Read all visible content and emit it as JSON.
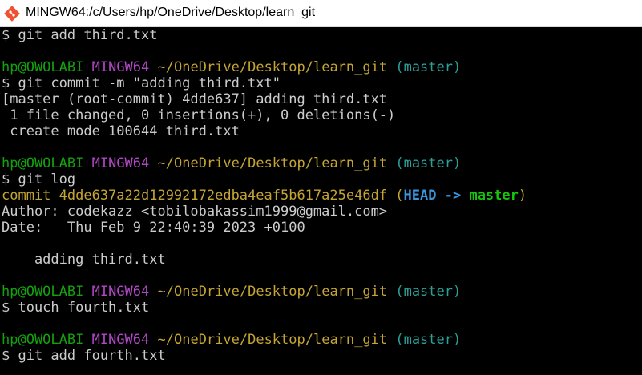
{
  "window": {
    "title": "MINGW64:/c/Users/hp/OneDrive/Desktop/learn_git",
    "app_icon": "git-bash-icon",
    "accent": "#f05133"
  },
  "prompt": {
    "user_host": "hp@OWOLABI",
    "system": "MINGW64",
    "path": "~/OneDrive/Desktop/learn_git",
    "branch": "(master)",
    "symbol": "$"
  },
  "terminal": {
    "lines": {
      "l0": "$ git add third.txt",
      "l2_cmd": "$ git commit -m \"adding third.txt\"",
      "l3": "[master (root-commit) 4dde637] adding third.txt",
      "l4": " 1 file changed, 0 insertions(+), 0 deletions(-)",
      "l5": " create mode 100644 third.txt",
      "l7_cmd": "$ git log",
      "l8_commit": "commit 4dde637a22d12992172edba4eaf5b617a25e46df",
      "l8_ref_open": "(",
      "l8_head": "HEAD ->",
      "l8_master": "master",
      "l8_ref_close": ")",
      "l9": "Author: codekazz <tobilobakassim1999@gmail.com>",
      "l10": "Date:   Thu Feb 9 22:40:39 2023 +0100",
      "l12": "    adding third.txt",
      "l14_cmd": "$ touch fourth.txt",
      "l16_cmd": "$ git add fourth.txt"
    }
  },
  "colors": {
    "user_host": "#13a10e",
    "system": "#b148c6",
    "path": "#c5a532",
    "branch": "#2aa198",
    "text": "#cccccc"
  }
}
